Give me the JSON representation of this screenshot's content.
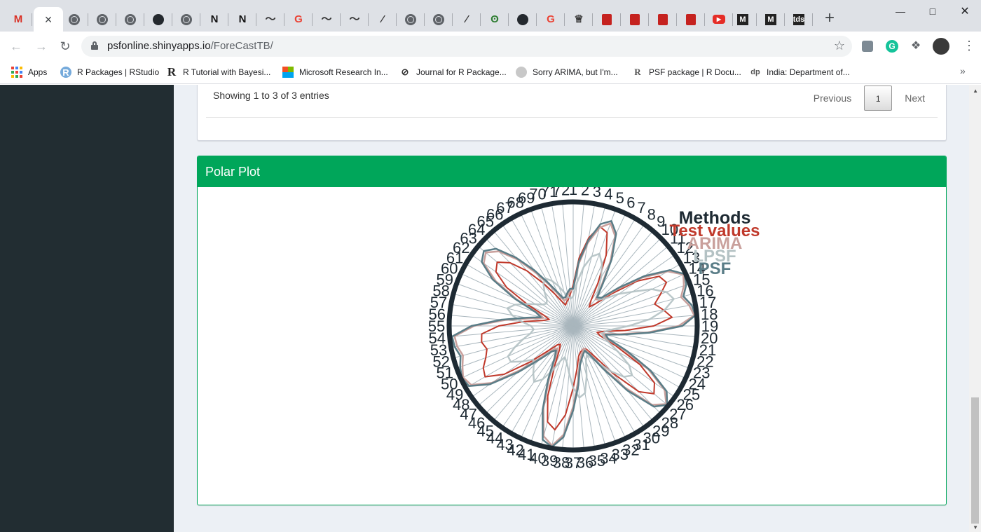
{
  "browser": {
    "tabs": [
      {
        "icon": "gmail-icon",
        "label": "M",
        "color": "#d93025"
      },
      {
        "icon": "close-icon",
        "label": "×",
        "active": true
      },
      {
        "icon": "globe-icon"
      },
      {
        "icon": "globe-icon"
      },
      {
        "icon": "globe-icon"
      },
      {
        "icon": "github-icon"
      },
      {
        "icon": "globe-icon"
      },
      {
        "icon": "notion-icon",
        "label": "N"
      },
      {
        "icon": "notion-icon",
        "label": "N"
      },
      {
        "icon": "squiggle-icon",
        "label": "～"
      },
      {
        "icon": "google-icon",
        "label": "G"
      },
      {
        "icon": "squiggle-icon",
        "label": "～"
      },
      {
        "icon": "squiggle-icon",
        "label": "～"
      },
      {
        "icon": "pen-icon",
        "label": "⁄"
      },
      {
        "icon": "globe-icon"
      },
      {
        "icon": "globe-icon"
      },
      {
        "icon": "pen-icon",
        "label": "⁄"
      },
      {
        "icon": "leaf-icon",
        "label": "ʘ"
      },
      {
        "icon": "github-icon"
      },
      {
        "icon": "google-icon",
        "label": "G"
      },
      {
        "icon": "crown-icon",
        "label": "♕"
      },
      {
        "icon": "book-red-icon"
      },
      {
        "icon": "book-red-icon"
      },
      {
        "icon": "book-red-icon"
      },
      {
        "icon": "book-red-icon"
      },
      {
        "icon": "youtube-icon",
        "label": "▶"
      },
      {
        "icon": "medium-icon",
        "label": "M"
      },
      {
        "icon": "medium-icon",
        "label": "M"
      },
      {
        "icon": "tds-icon",
        "label": "tds"
      }
    ],
    "new_tab": "+",
    "address": {
      "host": "psfonline.shinyapps.io",
      "path": "/ForeCastTB/"
    },
    "bookmarks": [
      {
        "icon": "apps-icon",
        "label": "Apps"
      },
      {
        "icon": "rstudio-icon",
        "label": "R Packages | RStudio"
      },
      {
        "icon": "r-letter-icon",
        "label": "R Tutorial with Bayesi..."
      },
      {
        "icon": "microsoft-icon",
        "label": "Microsoft Research In..."
      },
      {
        "icon": "journal-icon",
        "label": "Journal for R Package..."
      },
      {
        "icon": "globe-gray-icon",
        "label": "Sorry ARIMA, but I'm..."
      },
      {
        "icon": "r-doc-icon",
        "label": "PSF package | R Docu..."
      },
      {
        "icon": "dp-icon",
        "label": "India: Department of..."
      }
    ],
    "bookmarks_more": "»"
  },
  "table_footer": {
    "entries_info": "Showing 1 to 3 of 3 entries",
    "previous": "Previous",
    "current_page": "1",
    "next": "Next"
  },
  "polar_box": {
    "title": "Polar Plot"
  },
  "chart_data": {
    "type": "line",
    "subtype": "polar",
    "angular_ticks": [
      "1",
      "2",
      "3",
      "4",
      "5",
      "6",
      "7",
      "8",
      "9",
      "10",
      "11",
      "12",
      "13",
      "14",
      "15",
      "16",
      "17",
      "18",
      "19",
      "20",
      "21",
      "22",
      "23",
      "24",
      "25",
      "26",
      "27",
      "28",
      "29",
      "30",
      "31",
      "32",
      "33",
      "34",
      "35",
      "36",
      "37",
      "38",
      "39",
      "40",
      "41",
      "42",
      "43",
      "44",
      "45",
      "46",
      "47",
      "48",
      "49",
      "50",
      "51",
      "52",
      "53",
      "54",
      "55",
      "56",
      "57",
      "58",
      "59",
      "60",
      "61",
      "62",
      "63",
      "64",
      "65",
      "66",
      "67",
      "68",
      "69",
      "70",
      "71",
      "72"
    ],
    "legend": {
      "title": "Methods",
      "entries": [
        "Test values",
        "ARIMA",
        "LPSF",
        "PSF"
      ]
    },
    "radial_range": [
      0,
      1
    ],
    "series": [
      {
        "name": "Test values",
        "color": "#c0392b",
        "values": [
          0.33,
          0.55,
          0.72,
          0.83,
          0.8,
          0.63,
          0.4,
          0.25,
          0.2,
          0.25,
          0.4,
          0.63,
          0.8,
          0.83,
          0.75,
          0.68,
          0.74,
          0.8,
          0.65,
          0.42,
          0.25,
          0.2,
          0.23,
          0.38,
          0.62,
          0.8,
          0.85,
          0.75,
          0.5,
          0.3,
          0.22,
          0.2,
          0.21,
          0.22,
          0.25,
          0.35,
          0.5,
          0.72,
          0.85,
          0.8,
          0.6,
          0.35,
          0.22,
          0.18,
          0.2,
          0.28,
          0.45,
          0.68,
          0.82,
          0.8,
          0.75,
          0.72,
          0.75,
          0.74,
          0.6,
          0.4,
          0.25,
          0.2,
          0.25,
          0.4,
          0.62,
          0.76,
          0.8,
          0.72,
          0.58,
          0.42,
          0.3,
          0.22,
          0.18,
          0.2,
          0.22,
          0.26
        ]
      },
      {
        "name": "ARIMA",
        "color": "#c9a09c",
        "values": [
          0.3,
          0.5,
          0.68,
          0.82,
          0.88,
          0.8,
          0.6,
          0.4,
          0.28,
          0.3,
          0.45,
          0.68,
          0.88,
          0.98,
          0.95,
          0.9,
          0.95,
          0.98,
          0.85,
          0.6,
          0.38,
          0.25,
          0.28,
          0.45,
          0.7,
          0.9,
          0.98,
          0.9,
          0.65,
          0.4,
          0.25,
          0.2,
          0.22,
          0.25,
          0.3,
          0.45,
          0.65,
          0.88,
          0.98,
          0.92,
          0.7,
          0.45,
          0.28,
          0.22,
          0.25,
          0.35,
          0.55,
          0.8,
          0.95,
          0.98,
          0.95,
          0.92,
          0.95,
          0.96,
          0.8,
          0.55,
          0.35,
          0.25,
          0.3,
          0.5,
          0.72,
          0.88,
          0.92,
          0.85,
          0.7,
          0.52,
          0.38,
          0.28,
          0.22,
          0.22,
          0.25,
          0.28
        ]
      },
      {
        "name": "LPSF",
        "color": "#b4c2c4",
        "values": [
          0.24,
          0.35,
          0.48,
          0.58,
          0.62,
          0.55,
          0.45,
          0.35,
          0.3,
          0.3,
          0.35,
          0.45,
          0.55,
          0.7,
          0.8,
          0.84,
          0.75,
          0.62,
          0.45,
          0.32,
          0.26,
          0.24,
          0.26,
          0.32,
          0.42,
          0.55,
          0.62,
          0.58,
          0.48,
          0.38,
          0.3,
          0.26,
          0.3,
          0.42,
          0.55,
          0.58,
          0.5,
          0.38,
          0.3,
          0.26,
          0.3,
          0.4,
          0.5,
          0.55,
          0.5,
          0.45,
          0.42,
          0.5,
          0.58,
          0.58,
          0.5,
          0.42,
          0.35,
          0.32,
          0.34,
          0.42,
          0.5,
          0.55,
          0.5,
          0.42,
          0.35,
          0.3,
          0.28,
          0.3,
          0.36,
          0.42,
          0.44,
          0.4,
          0.34,
          0.28,
          0.24,
          0.22
        ]
      },
      {
        "name": "PSF",
        "color": "#5a7d87",
        "values": [
          0.3,
          0.52,
          0.7,
          0.85,
          0.9,
          0.82,
          0.62,
          0.42,
          0.3,
          0.32,
          0.48,
          0.7,
          0.9,
          0.99,
          0.97,
          0.92,
          0.97,
          0.99,
          0.88,
          0.62,
          0.4,
          0.27,
          0.3,
          0.48,
          0.72,
          0.92,
          0.99,
          0.92,
          0.68,
          0.42,
          0.27,
          0.22,
          0.24,
          0.27,
          0.32,
          0.48,
          0.68,
          0.9,
          0.99,
          0.95,
          0.72,
          0.48,
          0.3,
          0.24,
          0.27,
          0.38,
          0.58,
          0.82,
          0.97,
          0.99,
          0.97,
          0.94,
          0.97,
          0.98,
          0.82,
          0.58,
          0.38,
          0.27,
          0.32,
          0.52,
          0.75,
          0.9,
          0.94,
          0.88,
          0.72,
          0.55,
          0.4,
          0.3,
          0.24,
          0.24,
          0.27,
          0.3
        ]
      }
    ],
    "colors": {
      "frame": "#1e2a33",
      "spokes": "#a9b6bd",
      "legend_title": "#1e2a33"
    }
  }
}
